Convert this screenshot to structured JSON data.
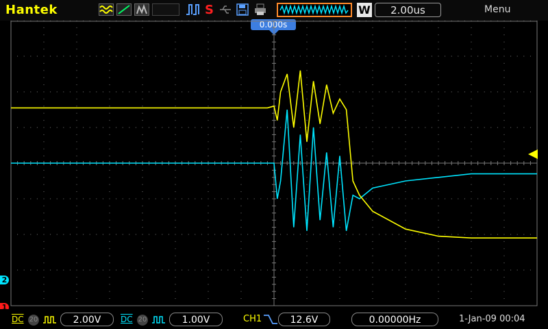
{
  "header": {
    "brand": "Hantek",
    "run_state": "S",
    "timebase": "2.00us",
    "menu_label": "Menu",
    "window_mode": "W",
    "trigger_position": "0.000s"
  },
  "footer": {
    "ch1_coupling": "DC",
    "ch1_bw": "20",
    "ch1_volts_div": "2.00V",
    "ch2_coupling": "DC",
    "ch2_bw": "20",
    "ch2_volts_div": "1.00V",
    "trigger_source": "CH1",
    "trigger_level": "12.6V",
    "frequency": "0.00000Hz",
    "datetime": "1-Jan-09 00:04"
  },
  "markers": {
    "ch1": "1",
    "ch2": "2"
  },
  "colors": {
    "ch1": "#ffff00",
    "ch2": "#00e5ff",
    "grid": "#7a7a7a",
    "trigger_badge": "#3d7ee0"
  },
  "chart_data": {
    "type": "line",
    "x_divisions": 16,
    "y_divisions": 8,
    "x_range_us": [
      -16,
      16
    ],
    "series": [
      {
        "name": "CH1",
        "volts_per_div": 2.0,
        "x_us": [
          -16,
          -8,
          -4,
          -0.4,
          0,
          0.2,
          0.4,
          0.8,
          1.2,
          1.6,
          2,
          2.4,
          2.8,
          3.2,
          3.6,
          4,
          4.4,
          4.8,
          5.2,
          6,
          8,
          10,
          12,
          14,
          16
        ],
        "y_div": [
          1.55,
          1.55,
          1.55,
          1.55,
          1.6,
          1.2,
          2.0,
          2.5,
          1.0,
          2.6,
          0.6,
          2.3,
          1.1,
          2.2,
          1.4,
          1.8,
          1.5,
          -0.5,
          -0.9,
          -1.35,
          -1.85,
          -2.05,
          -2.1,
          -2.1,
          -2.1
        ]
      },
      {
        "name": "CH2",
        "volts_per_div": 1.0,
        "x_us": [
          -16,
          -8,
          -4,
          -0.4,
          0,
          0.2,
          0.4,
          0.8,
          1.2,
          1.6,
          2,
          2.4,
          2.8,
          3.2,
          3.6,
          4,
          4.4,
          4.8,
          5.2,
          6,
          8,
          10,
          12,
          14,
          16
        ],
        "y_div": [
          0.0,
          0.0,
          0.0,
          0.0,
          0.0,
          -1.0,
          -0.5,
          1.5,
          -1.8,
          0.8,
          -1.9,
          1.0,
          -1.6,
          0.3,
          -1.8,
          0.2,
          -1.9,
          -0.9,
          -1.0,
          -0.7,
          -0.5,
          -0.4,
          -0.3,
          -0.3,
          -0.3
        ]
      }
    ]
  }
}
